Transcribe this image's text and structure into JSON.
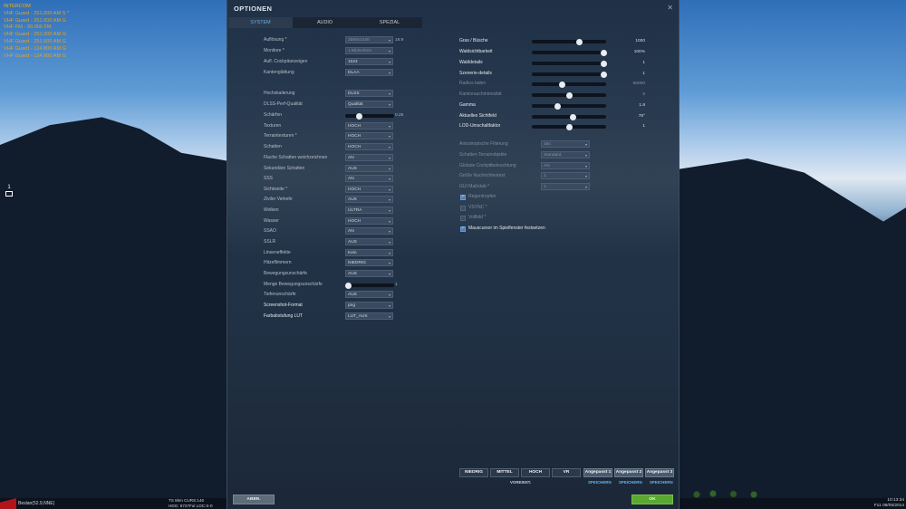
{
  "hud": {
    "radio": [
      "INTERCOM",
      "VHF Guard - 251.000 AM S *",
      "VHF Guard - 251.000 AM G",
      "VHF FM - 30.000 FM",
      "VHF Guard - 251.000 AM G",
      "VHF Guard - 251.000 AM G",
      "VHF Guard - 124.800 AM G",
      "VHF Guard - 124.800 AM G"
    ],
    "marker_number": "1",
    "location": "Beslan(52.9,NNE)",
    "mid_lines": [
      "TS    8km   CURS:146",
      "HDG:  9727Ful  LOC:X-0"
    ],
    "time_line1": "10:13:34",
    "time_line2": "F11 08/05/2014"
  },
  "window": {
    "title": "OPTIONEN",
    "close_icon": "✕",
    "tabs": [
      {
        "label": "SYSTEM"
      },
      {
        "label": "AUDIO"
      },
      {
        "label": "SPEZIAL"
      }
    ]
  },
  "left_settings": [
    {
      "label": "Auflösung *",
      "value": "2560x1440",
      "extra": "16:9",
      "dim": true
    },
    {
      "label": "Monitore *",
      "value": "1 Bildschirm",
      "dim": true
    },
    {
      "label": "Aufl. Cockpitanzeigen",
      "value": "1024"
    },
    {
      "label": "Kantenglättung",
      "value": "DLAA"
    },
    {
      "label": "Hochskalierung",
      "value": "DLSS"
    },
    {
      "label": "DLSS-Perf-Qualität",
      "value": "Qualität"
    },
    {
      "label": "Schärfen",
      "slider": 0.25,
      "slider_text": "0.25"
    },
    {
      "label": "Texturen",
      "value": "HOCH"
    },
    {
      "label": "Terraintexturen *",
      "value": "HOCH"
    },
    {
      "label": "Schatten",
      "value": "HOCH"
    },
    {
      "label": "Flache Schatten weichzeichnen",
      "value": "AN"
    },
    {
      "label": "Sekundäre Schatten",
      "value": "AUS"
    },
    {
      "label": "SSS",
      "value": "AN"
    },
    {
      "label": "Sichtweite *",
      "value": "HOCH"
    },
    {
      "label": "Ziviler Verkehr",
      "value": "AUS"
    },
    {
      "label": "Wolken",
      "value": "ULTRA"
    },
    {
      "label": "Wasser",
      "value": "HOCH"
    },
    {
      "label": "SSAO",
      "value": "AN"
    },
    {
      "label": "SSLR",
      "value": "AUS"
    },
    {
      "label": "Linseneffekte",
      "value": "Kein"
    },
    {
      "label": "Hitzeflimmern",
      "value": "NIEDRIG"
    },
    {
      "label": "Bewegungsunschärfe",
      "value": "AUS"
    },
    {
      "label": "Menge Bewegungsunschärfe",
      "slider": 0.0,
      "slider_text": "1"
    },
    {
      "label": "Tiefenunschärfe",
      "value": "AUS"
    },
    {
      "label": "Screenshot-Format",
      "value": "png",
      "bright": true
    },
    {
      "label": "Farbabstufung LUT",
      "value": "LUT_AUS",
      "bright": true
    }
  ],
  "right_sliders": [
    {
      "label": "Gras / Büsche",
      "fraction": 0.65,
      "value": "1000"
    },
    {
      "label": "Waldsichtbarkeit",
      "fraction": 1.0,
      "value": "100%"
    },
    {
      "label": "Walddetails",
      "fraction": 1.0,
      "value": "1"
    },
    {
      "label": "Szenerie-details",
      "fraction": 1.0,
      "value": "1"
    },
    {
      "label": "Radius laden",
      "fraction": 0.4,
      "value": "60000",
      "dim": true
    },
    {
      "label": "Kaminrauchintensität",
      "fraction": 0.5,
      "value": "5",
      "dim": true
    },
    {
      "label": "Gamma",
      "fraction": 0.33,
      "value": "1.8"
    },
    {
      "label": "Aktuelles Sichtfeld",
      "fraction": 0.55,
      "value": "78°"
    },
    {
      "label": "LOD-Umschaltfaktor",
      "fraction": 0.5,
      "value": "1"
    }
  ],
  "right_dropdowns": [
    {
      "label": "Anisotropische Filterung",
      "value": "16x"
    },
    {
      "label": "Schatten Terrainobjekte",
      "value": "Standard"
    },
    {
      "label": "Globale Cockpitbeleuchtung",
      "value": "AN"
    },
    {
      "label": "Größe Nachrichtentext",
      "value": "1"
    },
    {
      "label": "GUI Maßstab *",
      "value": "1"
    }
  ],
  "right_checkboxes": [
    {
      "label": "Regentropfen",
      "checked": true
    },
    {
      "label": "VSYNC *",
      "checked": false
    },
    {
      "label": "Vollbild *",
      "checked": false
    },
    {
      "label": "Mauscursor im Spielfenster festsetzen",
      "checked": true,
      "bright": true
    }
  ],
  "presets": {
    "buttons": [
      "NIEDRIG",
      "MITTEL",
      "HOCH",
      "VR",
      "Angepasst 1",
      "Angepasst 2",
      "Angepasst 3"
    ],
    "default_label": "VOREINST.",
    "save_label": "SPEICHERN"
  },
  "footer": {
    "cancel_label": "ABBR.",
    "ok_label": "OK"
  },
  "colors": {
    "accent": "#5fb4f0",
    "ok_green": "#5aa830",
    "hud_orange": "#e8a21c"
  }
}
